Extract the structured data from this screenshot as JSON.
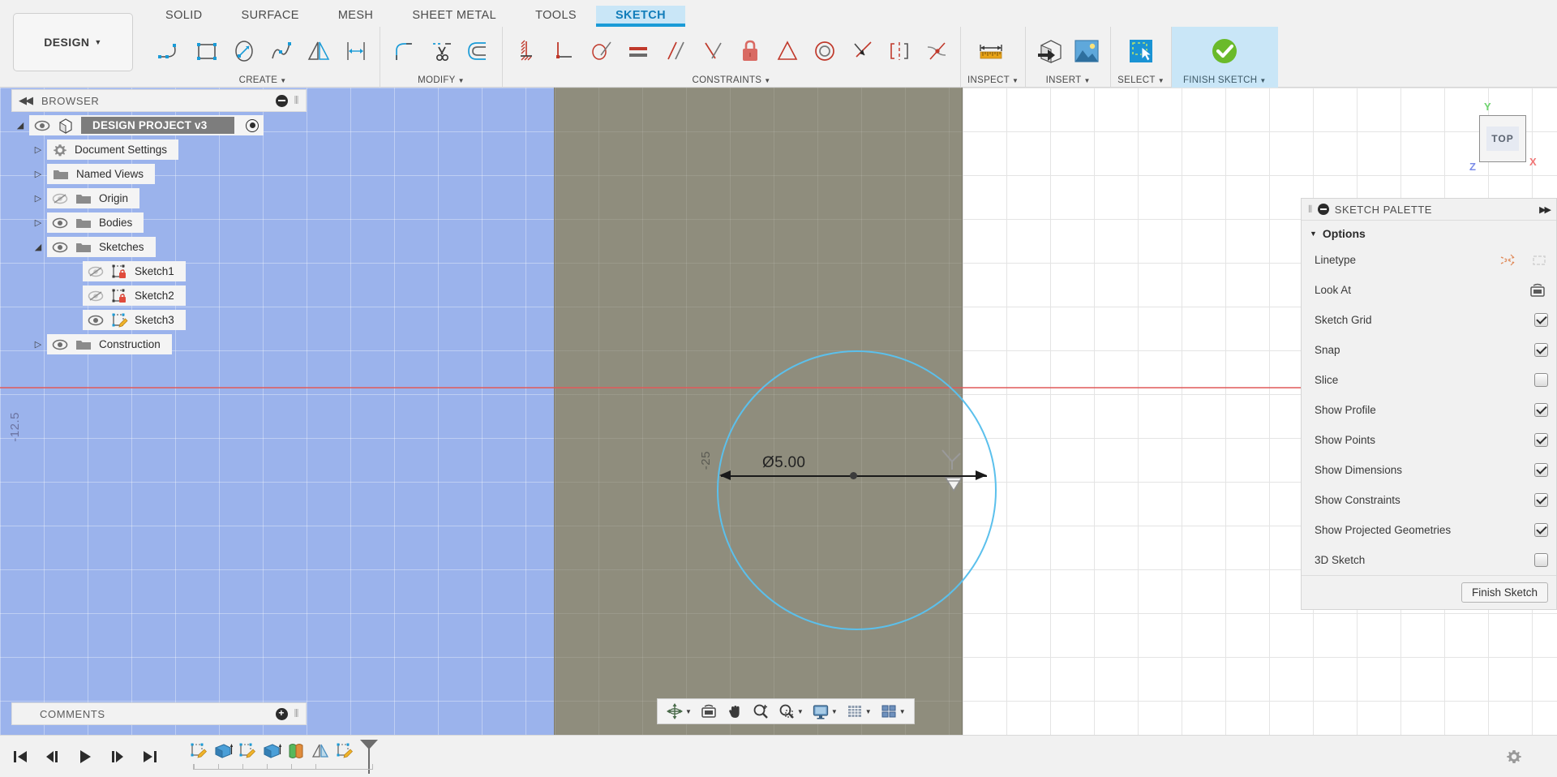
{
  "app": {
    "workspace_button": "DESIGN",
    "tabs": [
      "SOLID",
      "SURFACE",
      "MESH",
      "SHEET METAL",
      "TOOLS",
      "SKETCH"
    ],
    "active_tab": "SKETCH"
  },
  "ribbon": {
    "groups": [
      {
        "label": "CREATE",
        "name": "create-group",
        "has_dropdown": true,
        "tools": [
          {
            "name": "line-tool",
            "icon": "line-arc-icon"
          },
          {
            "name": "rectangle-tool",
            "icon": "rectangle-icon"
          },
          {
            "name": "circle-tool",
            "icon": "circle-icon"
          },
          {
            "name": "spline-tool",
            "icon": "spline-icon"
          },
          {
            "name": "mirror-tool",
            "icon": "mirror-icon"
          },
          {
            "name": "dimension-tool",
            "icon": "sketch-dimension-icon"
          }
        ]
      },
      {
        "label": "MODIFY",
        "name": "modify-group",
        "has_dropdown": true,
        "tools": [
          {
            "name": "fillet-tool",
            "icon": "fillet-icon"
          },
          {
            "name": "trim-tool",
            "icon": "scissors-icon"
          },
          {
            "name": "offset-tool",
            "icon": "offset-icon"
          }
        ]
      },
      {
        "label": "CONSTRAINTS",
        "name": "constraints-group",
        "has_dropdown": true,
        "tools": [
          {
            "name": "fix-unfix-constraint",
            "icon": "fix-icon"
          },
          {
            "name": "perpendicular-constraint",
            "icon": "perpendicular-icon"
          },
          {
            "name": "coincident-constraint",
            "icon": "coincident-icon"
          },
          {
            "name": "equal-constraint",
            "icon": "equal-icon"
          },
          {
            "name": "parallel-constraint",
            "icon": "parallel-icon"
          },
          {
            "name": "angle-constraint",
            "icon": "angle-icon"
          },
          {
            "name": "lock-constraint",
            "icon": "lock-icon"
          },
          {
            "name": "midpoint-constraint",
            "icon": "triangle-icon"
          },
          {
            "name": "concentric-constraint",
            "icon": "concentric-icon"
          },
          {
            "name": "tangent-constraint",
            "icon": "tangent-icon"
          },
          {
            "name": "symmetry-constraint",
            "icon": "symmetry-icon"
          },
          {
            "name": "curvature-constraint",
            "icon": "curvature-icon"
          }
        ]
      },
      {
        "label": "INSPECT",
        "name": "inspect-group",
        "has_dropdown": true,
        "tools": [
          {
            "name": "measure-tool",
            "icon": "ruler-icon"
          }
        ]
      },
      {
        "label": "INSERT",
        "name": "insert-group",
        "has_dropdown": true,
        "tools": [
          {
            "name": "insert-derive-tool",
            "icon": "insert-box-icon"
          },
          {
            "name": "insert-canvas-tool",
            "icon": "image-icon"
          }
        ]
      },
      {
        "label": "SELECT",
        "name": "select-group",
        "has_dropdown": true,
        "tools": [
          {
            "name": "select-tool",
            "icon": "select-window-icon"
          }
        ]
      },
      {
        "label": "FINISH SKETCH",
        "name": "finish-sketch-group",
        "has_dropdown": true,
        "highlighted": true,
        "tools": [
          {
            "name": "finish-sketch-tool",
            "icon": "green-check-icon"
          }
        ]
      }
    ]
  },
  "browser": {
    "title": "BROWSER",
    "root": {
      "label": "DESIGN PROJECT v3",
      "expanded": true,
      "visible": true
    },
    "items": [
      {
        "label": "Document Settings",
        "icon": "gear-icon",
        "expanded": false,
        "has_eye": false,
        "indent": 1
      },
      {
        "label": "Named Views",
        "icon": "folder-icon",
        "expanded": false,
        "has_eye": false,
        "indent": 1
      },
      {
        "label": "Origin",
        "icon": "folder-icon",
        "expanded": false,
        "has_eye": true,
        "visible": false,
        "indent": 1
      },
      {
        "label": "Bodies",
        "icon": "folder-icon",
        "expanded": false,
        "has_eye": true,
        "visible": true,
        "indent": 1
      },
      {
        "label": "Sketches",
        "icon": "folder-icon",
        "expanded": true,
        "has_eye": true,
        "visible": true,
        "indent": 1
      },
      {
        "label": "Sketch1",
        "icon": "sketch-locked-icon",
        "has_eye": true,
        "visible": false,
        "indent": 2
      },
      {
        "label": "Sketch2",
        "icon": "sketch-locked-icon",
        "has_eye": true,
        "visible": false,
        "indent": 2
      },
      {
        "label": "Sketch3",
        "icon": "sketch-editing-icon",
        "has_eye": true,
        "visible": true,
        "indent": 2
      },
      {
        "label": "Construction",
        "icon": "folder-icon",
        "expanded": false,
        "has_eye": true,
        "visible": true,
        "indent": 1
      }
    ]
  },
  "comments": {
    "title": "COMMENTS"
  },
  "sketch_palette": {
    "title": "SKETCH PALETTE",
    "section_label": "Options",
    "rows": [
      {
        "label": "Linetype",
        "control": "icons",
        "name": "linetype-row"
      },
      {
        "label": "Look At",
        "control": "icon",
        "name": "look-at-row"
      },
      {
        "label": "Sketch Grid",
        "control": "checkbox",
        "checked": true,
        "name": "sketch-grid-row"
      },
      {
        "label": "Snap",
        "control": "checkbox",
        "checked": true,
        "name": "snap-row"
      },
      {
        "label": "Slice",
        "control": "checkbox",
        "checked": false,
        "name": "slice-row"
      },
      {
        "label": "Show Profile",
        "control": "checkbox",
        "checked": true,
        "name": "show-profile-row"
      },
      {
        "label": "Show Points",
        "control": "checkbox",
        "checked": true,
        "name": "show-points-row"
      },
      {
        "label": "Show Dimensions",
        "control": "checkbox",
        "checked": true,
        "name": "show-dimensions-row"
      },
      {
        "label": "Show Constraints",
        "control": "checkbox",
        "checked": true,
        "name": "show-constraints-row"
      },
      {
        "label": "Show Projected Geometries",
        "control": "checkbox",
        "checked": true,
        "name": "show-projected-geometries-row"
      },
      {
        "label": "3D Sketch",
        "control": "checkbox",
        "checked": false,
        "name": "3d-sketch-row"
      }
    ],
    "finish_button": "Finish Sketch"
  },
  "canvas": {
    "dimension_label": "Ø5.00",
    "grid_label_left": "-12.5",
    "grid_label_plane": "-25",
    "viewcube": {
      "face": "TOP",
      "axis_x": "X",
      "axis_y": "Y",
      "axis_z": "Z",
      "color_x": "#f07575",
      "color_y": "#6ed46e",
      "color_z": "#7b8ce8"
    },
    "sketch_plane_color": "#8f8d7d",
    "grid_plane_color": "#9bb3ec",
    "circle_color": "#5bc0ec"
  },
  "navbar": {
    "items": [
      {
        "name": "orbit-button",
        "icon": "orbit-icon",
        "caret": true
      },
      {
        "name": "look-at-button",
        "icon": "look-at-icon",
        "caret": false
      },
      {
        "name": "pan-button",
        "icon": "hand-icon",
        "caret": false
      },
      {
        "name": "zoom-button",
        "icon": "magnifier-plus-icon",
        "caret": false
      },
      {
        "name": "zoom-window-button",
        "icon": "magnifier-window-icon",
        "caret": true
      },
      {
        "name": "display-settings-button",
        "icon": "monitor-icon",
        "caret": true
      },
      {
        "name": "grid-snaps-button",
        "icon": "grid-icon",
        "caret": true
      },
      {
        "name": "viewports-button",
        "icon": "viewports-icon",
        "caret": true
      }
    ]
  },
  "timeline": {
    "playback": [
      {
        "name": "go-to-beginning-button",
        "icon": "skip-back-icon"
      },
      {
        "name": "step-back-button",
        "icon": "step-back-icon"
      },
      {
        "name": "play-button",
        "icon": "play-icon"
      },
      {
        "name": "step-forward-button",
        "icon": "step-forward-icon"
      },
      {
        "name": "go-to-end-button",
        "icon": "skip-forward-icon"
      }
    ],
    "features": [
      {
        "name": "timeline-feature-sketch1",
        "icon": "sketch-feature-icon"
      },
      {
        "name": "timeline-feature-extrude1",
        "icon": "extrude-feature-icon"
      },
      {
        "name": "timeline-feature-sketch2",
        "icon": "sketch-feature-icon"
      },
      {
        "name": "timeline-feature-extrude2",
        "icon": "extrude-feature-icon"
      },
      {
        "name": "timeline-feature-appearance",
        "icon": "appearance-feature-icon"
      },
      {
        "name": "timeline-feature-mirror",
        "icon": "mirror-feature-icon"
      },
      {
        "name": "timeline-feature-sketch3",
        "icon": "sketch-feature-icon"
      }
    ],
    "settings_icon": "gear-icon"
  }
}
